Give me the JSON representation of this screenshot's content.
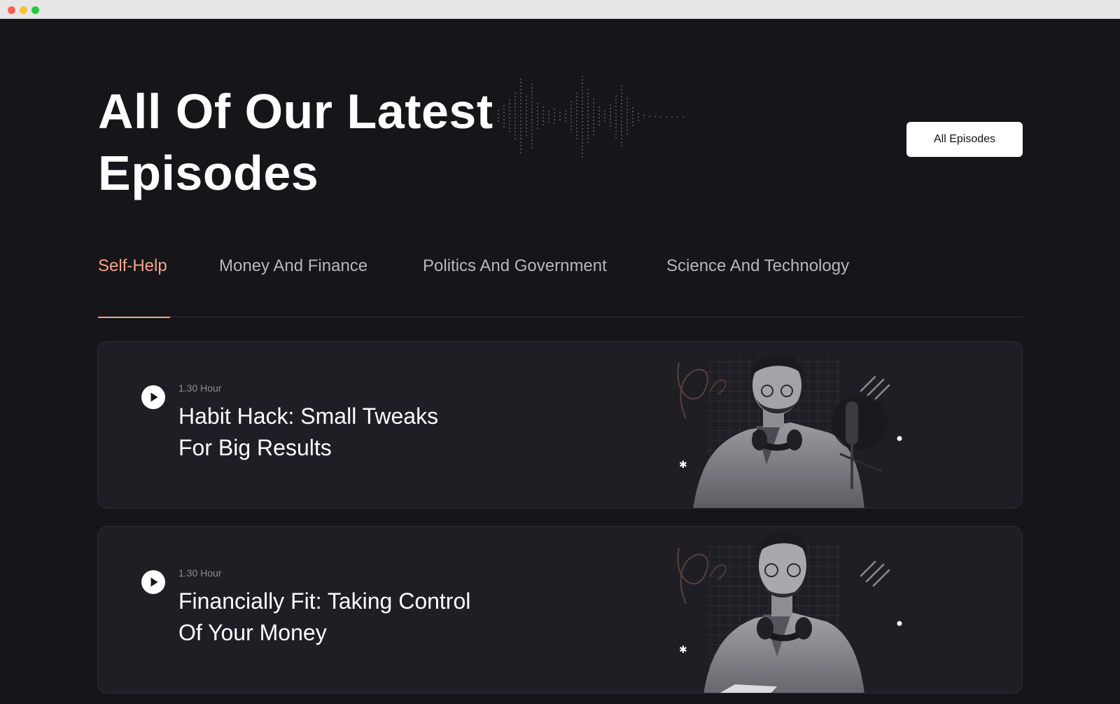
{
  "window": {
    "controls": [
      "close",
      "minimize",
      "zoom"
    ]
  },
  "hero": {
    "title_line1": "All Of Our Latest",
    "title_line2": "Episodes",
    "all_episodes_label": "All Episodes"
  },
  "tabs": [
    {
      "label": "Self-Help",
      "active": true
    },
    {
      "label": "Money And Finance",
      "active": false
    },
    {
      "label": "Politics And Government",
      "active": false
    },
    {
      "label": "Science And Technology",
      "active": false
    }
  ],
  "episodes": [
    {
      "duration": "1.30 Hour",
      "title_line1": "Habit Hack: Small Tweaks",
      "title_line2": "For Big Results",
      "image": "podcast-host-with-headphones-and-microphone"
    },
    {
      "duration": "1.30 Hour",
      "title_line1": "Financially Fit: Taking Control",
      "title_line2": "Of Your Money",
      "image": "podcast-host-with-headphones-reading"
    }
  ],
  "colors": {
    "background": "#161519",
    "card": "#1f1e24",
    "accent": "#f3a389",
    "tab_inactive": "#b6b6bc",
    "muted_text": "#8e8d95"
  },
  "icons": {
    "play": "play-icon",
    "waveform": "waveform-decoration"
  }
}
